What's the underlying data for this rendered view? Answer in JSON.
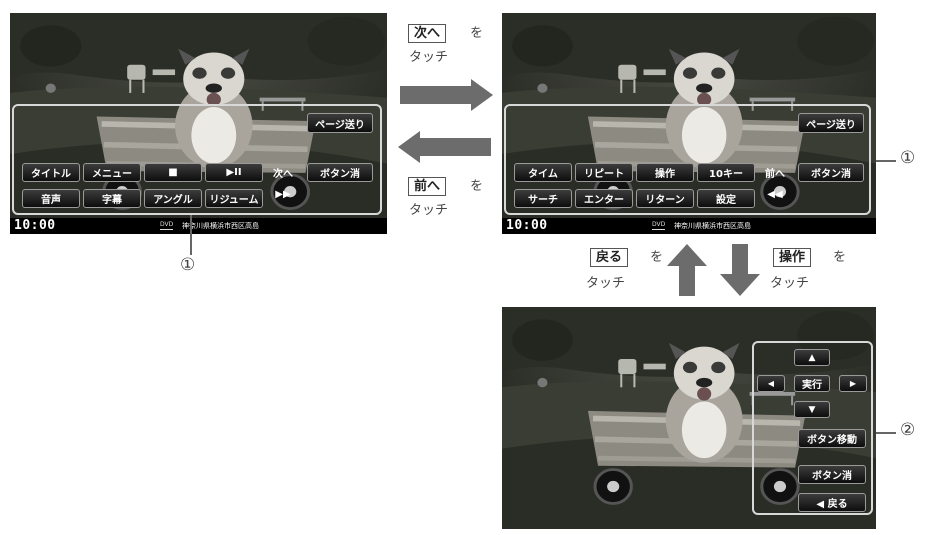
{
  "status": {
    "time": "10:00",
    "source": "DVD",
    "location": "神奈川県横浜市西区高島"
  },
  "screen1": {
    "page_button": "ページ送り",
    "row1": [
      "タイトル",
      "メニュー",
      "■",
      "▶II",
      "次へ"
    ],
    "row2": [
      "音声",
      "字幕",
      "アングル",
      "リジューム",
      "▶▶"
    ],
    "hide_button": "ボタン消"
  },
  "screen2": {
    "page_button": "ページ送り",
    "row1": [
      "タイム",
      "リピート",
      "操作",
      "10キー",
      "前へ"
    ],
    "row2": [
      "サーチ",
      "エンター",
      "リターン",
      "設定",
      "◀◀"
    ],
    "hide_button": "ボタン消"
  },
  "screen3": {
    "up": "▲",
    "left": "◀",
    "enter": "実行",
    "right": "▶",
    "down": "▼",
    "move_button": "ボタン移動",
    "hide_button": "ボタン消",
    "back_button": "◀  戻る"
  },
  "flow": {
    "next_key": "次へ",
    "next_suffix": "を",
    "next_caption": "タッチ",
    "prev_key": "前へ",
    "prev_suffix": "を",
    "prev_caption": "タッチ",
    "back_key": "戻る",
    "back_suffix": "を",
    "back_caption": "タッチ",
    "op_key": "操作",
    "op_suffix": "を",
    "op_caption": "タッチ"
  },
  "callouts": {
    "c1_left": "①",
    "c1_right": "①",
    "c2": "②"
  }
}
